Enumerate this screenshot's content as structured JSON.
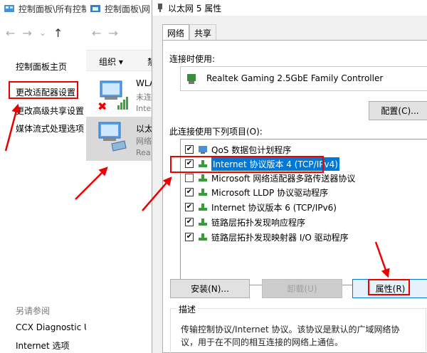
{
  "w1": {
    "title": "控制面板\\所有控制",
    "nav": {
      "back": "←",
      "forward": "→",
      "dropdown": "⌄",
      "up": "↑"
    },
    "links": [
      "控制面板主页",
      "更改适配器设置",
      "更改高级共享设置",
      "媒体流式处理选项"
    ],
    "see_also": "另请参阅",
    "see_also_links": [
      "CCX Diagnostic U",
      "Internet 选项"
    ]
  },
  "w2": {
    "title": "控制面板\\网",
    "nav": {
      "back": "←",
      "forward": "→"
    },
    "organize": "组织 ▾",
    "toolbar_extra": "禁",
    "adapters": [
      {
        "name": "WLA",
        "status1": "未连",
        "status2": "Inte"
      },
      {
        "name": "以太",
        "status1": "网络",
        "status2": "Rea"
      }
    ]
  },
  "dialog": {
    "title": "以太网 5 属性",
    "tabs": [
      "网络",
      "共享"
    ],
    "connect_using_label": "连接时使用:",
    "device_name": "Realtek Gaming 2.5GbE Family Controller",
    "configure_button": "配置(C)...",
    "items_label": "此连接使用下列项目(O):",
    "items": [
      {
        "label": "QoS 数据包计划程序",
        "checked": true,
        "icon": "qos-scheduler-icon"
      },
      {
        "label": "Internet 协议版本 4 (TCP/IPv4)",
        "checked": true,
        "icon": "protocol-icon",
        "selected": true
      },
      {
        "label": "Microsoft 网络适配器多路传送器协议",
        "checked": false,
        "icon": "protocol-icon"
      },
      {
        "label": "Microsoft LLDP 协议驱动程序",
        "checked": true,
        "icon": "protocol-icon"
      },
      {
        "label": "Internet 协议版本 6 (TCP/IPv6)",
        "checked": true,
        "icon": "protocol-icon"
      },
      {
        "label": "链路层拓扑发现响应程序",
        "checked": true,
        "icon": "protocol-icon"
      },
      {
        "label": "链路层拓扑发现映射器 I/O 驱动程序",
        "checked": true,
        "icon": "protocol-icon"
      }
    ],
    "install_button": "安装(N)...",
    "uninstall_button": "卸载(U)",
    "properties_button": "属性(R)",
    "description_label": "描述",
    "description_text": "传输控制协议/Internet 协议。该协议是默认的广域网络协议，用于在不同的相互连接的网络上通信。"
  },
  "colors": {
    "highlight": "#0078d7",
    "annotation": "#e00000"
  }
}
